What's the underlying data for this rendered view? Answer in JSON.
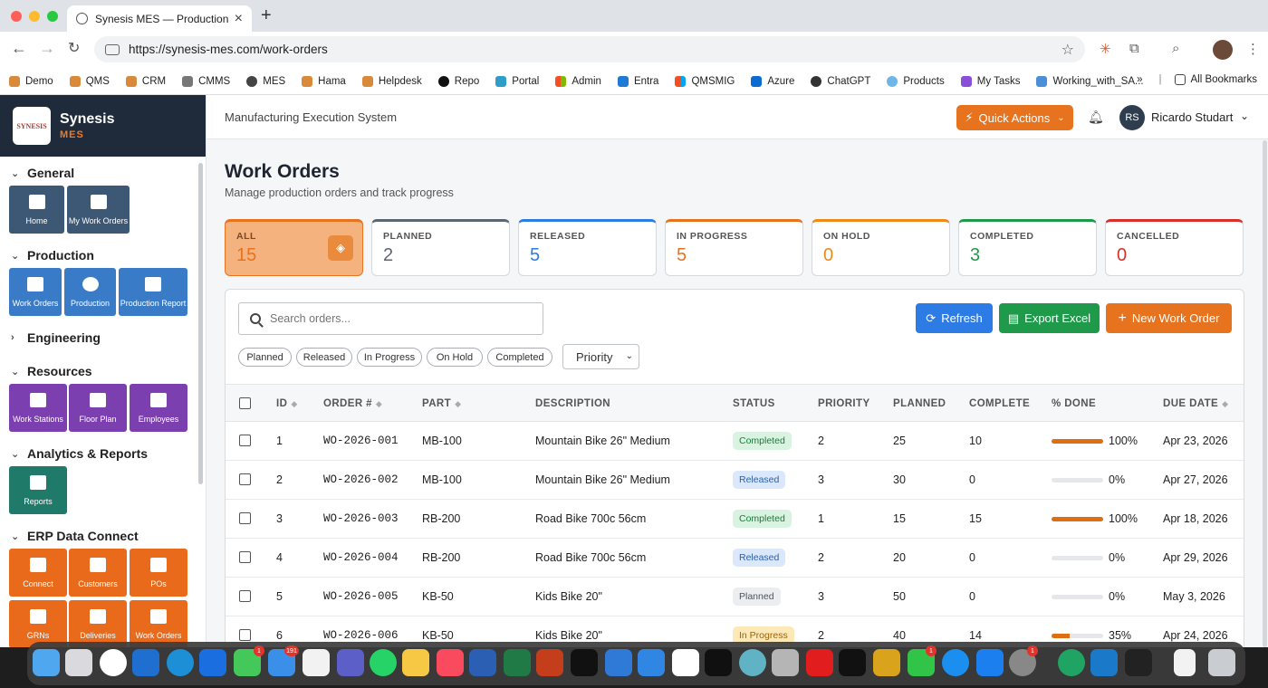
{
  "browser": {
    "tab_title": "Synesis MES — Production Tr",
    "url": "https://synesis-mes.com/work-orders",
    "bookmarks": [
      "Demo",
      "QMS",
      "CRM",
      "CMMS",
      "MES",
      "Hama",
      "Helpdesk",
      "Repo",
      "Portal",
      "Admin",
      "Entra",
      "QMSMIG",
      "Azure",
      "ChatGPT",
      "Products",
      "My Tasks",
      "Working_with_SA..."
    ],
    "all_bookmarks": "All Bookmarks"
  },
  "brand": {
    "name": "Synesis",
    "sub": "MES",
    "logo_text": "SYNESIS"
  },
  "sidebar": {
    "general": {
      "title": "General",
      "items": [
        "Home",
        "My Work Orders"
      ]
    },
    "production": {
      "title": "Production",
      "items": [
        "Work Orders",
        "Production",
        "Production Report"
      ]
    },
    "engineering": {
      "title": "Engineering"
    },
    "resources": {
      "title": "Resources",
      "items": [
        "Work Stations",
        "Floor Plan",
        "Employees"
      ]
    },
    "analytics": {
      "title": "Analytics & Reports",
      "items": [
        "Reports"
      ]
    },
    "erp": {
      "title": "ERP Data Connect",
      "items": [
        "Connect",
        "Customers",
        "POs",
        "GRNs",
        "Deliveries",
        "Work Orders"
      ]
    }
  },
  "topbar": {
    "system_title": "Manufacturing Execution System",
    "quick_actions": "Quick Actions",
    "user_initials": "RS",
    "user_name": "Ricardo Studart"
  },
  "page": {
    "title": "Work Orders",
    "subtitle": "Manage production orders and track progress"
  },
  "stats": [
    {
      "label": "ALL",
      "value": "15",
      "color": "#e8731e"
    },
    {
      "label": "PLANNED",
      "value": "2",
      "color": "#5b6673"
    },
    {
      "label": "RELEASED",
      "value": "5",
      "color": "#2d7be5"
    },
    {
      "label": "IN PROGRESS",
      "value": "5",
      "color": "#e8731e"
    },
    {
      "label": "ON HOLD",
      "value": "0",
      "color": "#ee8a1a"
    },
    {
      "label": "COMPLETED",
      "value": "3",
      "color": "#1f9a4b"
    },
    {
      "label": "CANCELLED",
      "value": "0",
      "color": "#d9302b"
    }
  ],
  "toolbar": {
    "search_placeholder": "Search orders...",
    "refresh": "Refresh",
    "export": "Export Excel",
    "new_order": "New Work Order",
    "filters": [
      "Planned",
      "Released",
      "In Progress",
      "On Hold",
      "Completed"
    ],
    "priority": "Priority"
  },
  "table": {
    "headers": [
      "ID",
      "ORDER #",
      "PART",
      "DESCRIPTION",
      "STATUS",
      "PRIORITY",
      "PLANNED",
      "COMPLETE",
      "% DONE",
      "DUE DATE"
    ],
    "rows": [
      {
        "id": "1",
        "order": "WO-2026-001",
        "part": "MB-100",
        "desc": "Mountain Bike 26\" Medium",
        "status": "Completed",
        "priority": "2",
        "planned": "25",
        "complete": "10",
        "done": "100%",
        "done_frac": 1.0,
        "due": "Apr 23, 2026"
      },
      {
        "id": "2",
        "order": "WO-2026-002",
        "part": "MB-100",
        "desc": "Mountain Bike 26\" Medium",
        "status": "Released",
        "priority": "3",
        "planned": "30",
        "complete": "0",
        "done": "0%",
        "done_frac": 0.0,
        "due": "Apr 27, 2026"
      },
      {
        "id": "3",
        "order": "WO-2026-003",
        "part": "RB-200",
        "desc": "Road Bike 700c 56cm",
        "status": "Completed",
        "priority": "1",
        "planned": "15",
        "complete": "15",
        "done": "100%",
        "done_frac": 1.0,
        "due": "Apr 18, 2026"
      },
      {
        "id": "4",
        "order": "WO-2026-004",
        "part": "RB-200",
        "desc": "Road Bike 700c 56cm",
        "status": "Released",
        "priority": "2",
        "planned": "20",
        "complete": "0",
        "done": "0%",
        "done_frac": 0.0,
        "due": "Apr 29, 2026"
      },
      {
        "id": "5",
        "order": "WO-2026-005",
        "part": "KB-50",
        "desc": "Kids Bike 20\"",
        "status": "Planned",
        "priority": "3",
        "planned": "50",
        "complete": "0",
        "done": "0%",
        "done_frac": 0.0,
        "due": "May 3, 2026"
      },
      {
        "id": "6",
        "order": "WO-2026-006",
        "part": "KB-50",
        "desc": "Kids Bike 20\"",
        "status": "In Progress",
        "priority": "2",
        "planned": "40",
        "complete": "14",
        "done": "35%",
        "done_frac": 0.35,
        "due": "Apr 24, 2026"
      }
    ]
  },
  "dock": {
    "badges": [
      "1",
      "191",
      "1",
      "1",
      "1"
    ]
  }
}
